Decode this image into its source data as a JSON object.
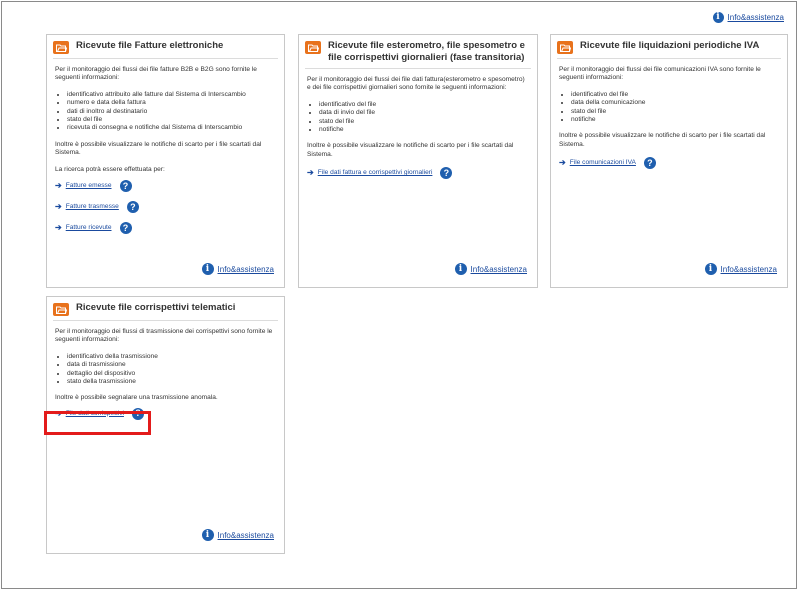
{
  "top_info": {
    "label": "Info&assistenza"
  },
  "cards": {
    "fatture": {
      "title": "Ricevute file Fatture elettroniche",
      "intro": "Per il monitoraggio dei flussi dei file fatture B2B e B2G sono fornite le seguenti informazioni:",
      "items": [
        "identificativo attribuito alle fatture dal Sistema di Interscambio",
        "numero e data della fattura",
        "dati di inoltro al destinatario",
        "stato del file",
        "ricevuta di consegna e notifiche dal Sistema di Interscambio"
      ],
      "note": "Inoltre è possibile visualizzare le notifiche di scarto per i file scartati dal Sistema.",
      "search_label": "La ricerca potrà  essere effettuata per:",
      "links": [
        "Fatture emesse",
        "Fatture trasmesse",
        "Fatture ricevute"
      ],
      "footer": "Info&assistenza"
    },
    "esterometro": {
      "title": "Ricevute file esterometro, file spesometro e file corrispettivi giornalieri (fase transitoria)",
      "intro": "Per il monitoraggio dei flussi dei file dati fattura(esterometro e spesometro) e dei file corrispettivi giornalieri sono fornite le seguenti informazioni:",
      "items": [
        "identificativo del file",
        "data di invio del file",
        "stato del file",
        "notifiche"
      ],
      "note": "Inoltre è possibile visualizzare le notifiche di scarto per i file scartati dal Sistema.",
      "links": [
        "File dati fattura e corrispettivi giornalieri"
      ],
      "footer": "Info&assistenza"
    },
    "liquidazioni": {
      "title": "Ricevute file liquidazioni periodiche IVA",
      "intro": "Per il monitoraggio dei flussi dei file comunicazioni IVA sono fornite le seguenti informazioni:",
      "items": [
        "identificativo del file",
        "data della comunicazione",
        "stato del file",
        "notifiche"
      ],
      "note": "Inoltre è possibile visualizzare le notifiche di scarto per i file scartati dal Sistema.",
      "links": [
        "File comunicazioni IVA"
      ],
      "footer": "Info&assistenza"
    },
    "corrispettivi": {
      "title": "Ricevute file corrispettivi telematici",
      "intro": "Per il monitoraggio dei flussi di trasmissione dei corrispettivi sono fornite le seguenti informazioni:",
      "items": [
        "identificativo della trasmissione",
        "data di trasmissione",
        "dettaglio del dispositivo",
        "stato della trasmissione"
      ],
      "note": "Inoltre è possibile segnalare una trasmissione anomala.",
      "links": [
        "File dati corrispettivi"
      ],
      "footer": "Info&assistenza"
    }
  },
  "colors": {
    "accent": "#e8721c",
    "link": "#1a4a9e",
    "icon": "#1f5fae",
    "highlight": "#e31b1b"
  }
}
